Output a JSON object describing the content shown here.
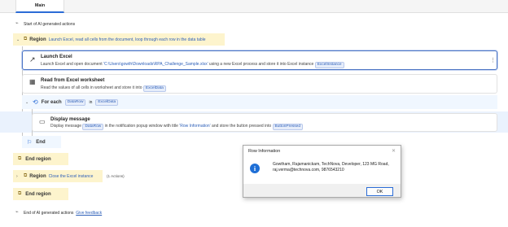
{
  "tabs": [
    {
      "label": "Main"
    }
  ],
  "flow": {
    "start_comment": "Start of AI generated actions",
    "region1": {
      "keyword": "Region",
      "description": "Launch Excel, read all cells from the document, loop through each row in the data table"
    },
    "launch_excel": {
      "title": "Launch Excel",
      "desc_prefix": "Launch Excel and open document ",
      "path": "'C:\\Users\\gowth\\Downloads\\RPA_Challenge_Sample.xlsx'",
      "desc_middle": " using a new Excel process and store it into Excel instance ",
      "var": "ExcelInstance"
    },
    "read_excel": {
      "title": "Read from Excel worksheet",
      "desc_prefix": "Read the values of all cells in worksheet and store it into ",
      "var": "ExcelData"
    },
    "for_each": {
      "keyword": "For each",
      "item_var": "DataRow",
      "in_label": "in",
      "collection_var": "ExcelData"
    },
    "display_message": {
      "title": "Display message",
      "desc_prefix": "Display message ",
      "var1": "DataRow",
      "desc_middle": " in the notification popup window with title ",
      "title_value": "'Row Information'",
      "desc_suffix": " and store the button pressed into ",
      "var2": "ButtonPressed"
    },
    "end_loop": "End",
    "end_region1": "End region",
    "region2": {
      "keyword": "Region",
      "description": "Close the Excel instance",
      "count": "(1 Actions)"
    },
    "end_region2": "End region",
    "end_comment": "End of AI generated actions",
    "feedback_link": "Give feedback"
  },
  "dialog": {
    "title": "Row Information",
    "message": "Gowtham, Rajamanickam, TechNova, Developer, 123 MG Road, raj.verma@technova.com, 9876543210",
    "ok_label": "OK"
  },
  "colors": {
    "region_bg": "#fdf4cd",
    "accent": "#2b6cd6",
    "selected_row_bg": "#eaf2fd",
    "variable_chip": "#e6edfa"
  }
}
